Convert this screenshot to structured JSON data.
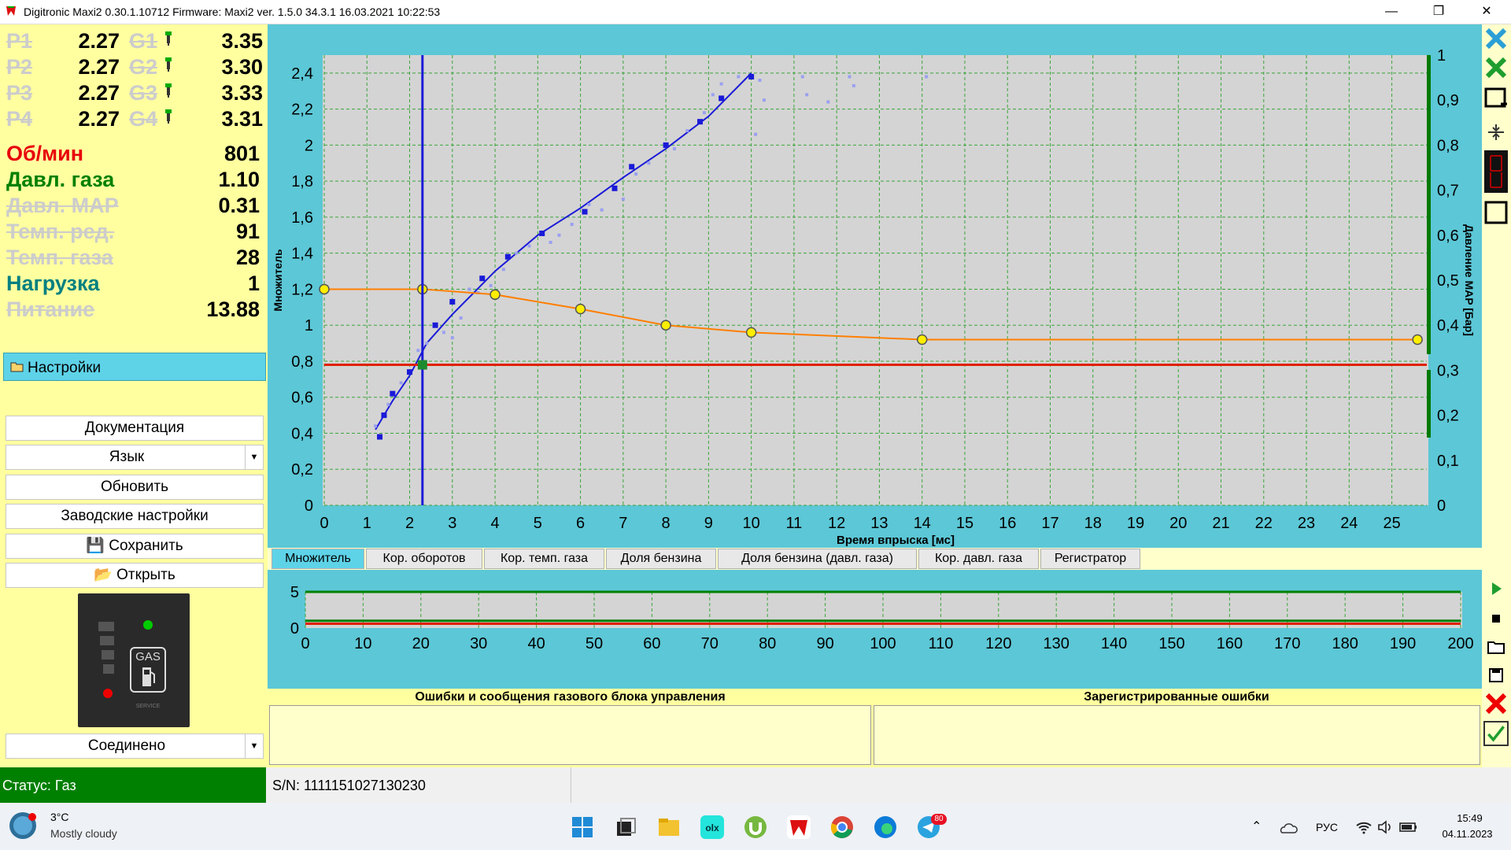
{
  "window": {
    "title": "Digitronic Maxi2 0.30.1.10712 Firmware: Maxi2  ver. 1.5.0  34.3.1   16.03.2021 10:22:53",
    "minimize": "—",
    "restore": "❐",
    "close": "✕"
  },
  "readings": {
    "p_rows": [
      {
        "label": "P1",
        "value": "2.27",
        "g_label": "G1",
        "g_value": "3.35"
      },
      {
        "label": "P2",
        "value": "2.27",
        "g_label": "G2",
        "g_value": "3.30"
      },
      {
        "label": "P3",
        "value": "2.27",
        "g_label": "G3",
        "g_value": "3.33"
      },
      {
        "label": "P4",
        "value": "2.27",
        "g_label": "G4",
        "g_value": "3.31"
      }
    ],
    "params": [
      {
        "label": "Об/мин",
        "value": "801",
        "color": "#e8000b",
        "active": true
      },
      {
        "label": "Давл. газа",
        "value": "1.10",
        "color": "#008000",
        "active": true
      },
      {
        "label": "Давл. МАР",
        "value": "0.31",
        "color": "#cccccc",
        "active": false
      },
      {
        "label": "Темп. ред.",
        "value": "91",
        "color": "#cccccc",
        "active": false
      },
      {
        "label": "Темп. газа",
        "value": "28",
        "color": "#cccccc",
        "active": false
      },
      {
        "label": "Нагрузка",
        "value": "1",
        "color": "#008080",
        "active": true
      },
      {
        "label": "Питание",
        "value": "13.88",
        "color": "#cccccc",
        "active": false
      }
    ]
  },
  "menu": {
    "settings": "Настройки",
    "documentation": "Документация",
    "language": "Язык",
    "update": "Обновить",
    "factory": "Заводские настройки",
    "save": "Сохранить",
    "open": "Открыть",
    "connection": "Соединено"
  },
  "device": {
    "gas_label": "GAS",
    "service_label": "SERVICE"
  },
  "tabs": [
    "Множитель",
    "Кор. оборотов",
    "Кор. темп. газа",
    "Доля бензина",
    "Доля бензина (давл. газа)",
    "Кор. давл. газа",
    "Регистратор"
  ],
  "errors": {
    "left_title": "Ошибки и сообщения газового блока управления",
    "right_title": "Зарегистрированные ошибки"
  },
  "status": {
    "state": "Статус: Газ",
    "serial": "S/N: 1111151027130230"
  },
  "taskbar": {
    "temp": "3°C",
    "weather": "Mostly cloudy",
    "lang": "РУС",
    "time": "15:49",
    "date": "04.11.2023",
    "telegram_badge": "80"
  },
  "colors": {
    "accent_cyan": "#5cc7d6",
    "panel_yellow": "#ffffa0",
    "status_green": "#008000",
    "series_blue": "#1a1ad8",
    "series_orange": "#ff7f00",
    "limit_red": "#e02000"
  },
  "chart_data": [
    {
      "type": "scatter",
      "xlabel": "Время впрыска [мс]",
      "ylabel": "Множитель",
      "y2label": "Давление MAP [Бар]",
      "xlim": [
        0,
        25.8
      ],
      "ylim": [
        0,
        2.5
      ],
      "y2lim": [
        0,
        1
      ],
      "x_ticks": [
        0,
        1,
        2,
        3,
        4,
        5,
        6,
        7,
        8,
        9,
        10,
        11,
        12,
        13,
        14,
        15,
        16,
        17,
        18,
        19,
        20,
        21,
        22,
        23,
        24,
        25
      ],
      "y_ticks": [
        "0",
        "0,2",
        "0,4",
        "0,6",
        "0,8",
        "1",
        "1,2",
        "1,4",
        "1,6",
        "1,8",
        "2",
        "2,2",
        "2,4"
      ],
      "y_tick_values": [
        0,
        0.2,
        0.4,
        0.6,
        0.8,
        1,
        1.2,
        1.4,
        1.6,
        1.8,
        2,
        2.2,
        2.4
      ],
      "y2_ticks": [
        "0",
        "0,1",
        "0,2",
        "0,3",
        "0,4",
        "0,5",
        "0,6",
        "0,7",
        "0,8",
        "0,9",
        "1"
      ],
      "y2_tick_values": [
        0,
        0.1,
        0.2,
        0.3,
        0.4,
        0.5,
        0.6,
        0.7,
        0.8,
        0.9,
        1
      ],
      "grid": true,
      "series": [
        {
          "kind": "fit-line",
          "color": "#1a1ad8",
          "points": [
            [
              1.2,
              0.42
            ],
            [
              1.6,
              0.58
            ],
            [
              2,
              0.72
            ],
            [
              2.4,
              0.9
            ],
            [
              3,
              1.06
            ],
            [
              3.5,
              1.18
            ],
            [
              4,
              1.3
            ],
            [
              5,
              1.5
            ],
            [
              6,
              1.65
            ],
            [
              7,
              1.82
            ],
            [
              8,
              1.98
            ],
            [
              9,
              2.16
            ],
            [
              10,
              2.4
            ]
          ]
        },
        {
          "kind": "main-points",
          "color": "#1a1ad8",
          "points": [
            [
              1.3,
              0.38
            ],
            [
              1.4,
              0.5
            ],
            [
              1.6,
              0.62
            ],
            [
              2,
              0.74
            ],
            [
              2.6,
              1.0
            ],
            [
              3,
              1.13
            ],
            [
              3.7,
              1.26
            ],
            [
              4.3,
              1.38
            ],
            [
              5.1,
              1.51
            ],
            [
              6.1,
              1.63
            ],
            [
              6.8,
              1.76
            ],
            [
              7.2,
              1.88
            ],
            [
              8,
              2.0
            ],
            [
              8.8,
              2.13
            ],
            [
              9.3,
              2.26
            ],
            [
              10,
              2.38
            ]
          ]
        },
        {
          "kind": "scatter-cloud",
          "color": "#9aa0f0",
          "points": [
            [
              1.2,
              0.44
            ],
            [
              1.5,
              0.56
            ],
            [
              1.8,
              0.68
            ],
            [
              2.2,
              0.86
            ],
            [
              2.4,
              0.9
            ],
            [
              2.8,
              0.96
            ],
            [
              3,
              0.93
            ],
            [
              3.2,
              1.04
            ],
            [
              3.4,
              1.2
            ],
            [
              3.6,
              1.18
            ],
            [
              3.9,
              1.22
            ],
            [
              4.2,
              1.31
            ],
            [
              4.5,
              1.4
            ],
            [
              4.8,
              1.44
            ],
            [
              5.3,
              1.46
            ],
            [
              5.5,
              1.5
            ],
            [
              5.8,
              1.56
            ],
            [
              6.2,
              1.67
            ],
            [
              6.5,
              1.64
            ],
            [
              7,
              1.7
            ],
            [
              7.3,
              1.84
            ],
            [
              7.6,
              1.9
            ],
            [
              8.2,
              1.98
            ],
            [
              8.5,
              2.08
            ],
            [
              8.9,
              2.18
            ],
            [
              9.1,
              2.28
            ],
            [
              9.3,
              2.34
            ],
            [
              9.7,
              2.38
            ],
            [
              10.2,
              2.36
            ],
            [
              10.3,
              2.25
            ],
            [
              10.1,
              2.06
            ],
            [
              11.2,
              2.38
            ],
            [
              11.3,
              2.28
            ],
            [
              11.8,
              2.24
            ],
            [
              12.3,
              2.38
            ],
            [
              12.4,
              2.33
            ],
            [
              14.1,
              2.38
            ]
          ]
        },
        {
          "kind": "orange-curve",
          "color": "#ff7f00",
          "points": [
            [
              0,
              1.2
            ],
            [
              2.3,
              1.2
            ],
            [
              4,
              1.17
            ],
            [
              6,
              1.09
            ],
            [
              8,
              1.0
            ],
            [
              10,
              0.96
            ],
            [
              14,
              0.92
            ],
            [
              25.6,
              0.92
            ]
          ],
          "markers": [
            [
              0,
              1.2
            ],
            [
              2.3,
              1.2
            ],
            [
              4,
              1.17
            ],
            [
              6,
              1.09
            ],
            [
              8,
              1.0
            ],
            [
              10,
              0.96
            ],
            [
              14,
              0.92
            ],
            [
              25.6,
              0.92
            ]
          ]
        },
        {
          "kind": "hline",
          "color": "#e02000",
          "y": 0.78
        },
        {
          "kind": "vline",
          "color": "#1a1ad8",
          "x": 2.3
        }
      ],
      "cursor_point": [
        2.3,
        0.78
      ]
    },
    {
      "type": "line",
      "xlim": [
        0,
        200
      ],
      "ylim": [
        0,
        5
      ],
      "x_ticks": [
        0,
        10,
        20,
        30,
        40,
        50,
        60,
        70,
        80,
        90,
        100,
        110,
        120,
        130,
        140,
        150,
        160,
        170,
        180,
        190,
        200
      ],
      "y_ticks": [
        "0",
        "5"
      ],
      "y_tick_values": [
        0,
        5
      ],
      "series": [
        {
          "color": "#008000",
          "values": [
            [
              0,
              5
            ],
            [
              200,
              5
            ]
          ]
        },
        {
          "color": "#008000",
          "values": [
            [
              0,
              1
            ],
            [
              200,
              1
            ]
          ]
        },
        {
          "color": "#e02000",
          "values": [
            [
              0,
              0.6
            ],
            [
              200,
              0.6
            ]
          ]
        }
      ]
    }
  ]
}
